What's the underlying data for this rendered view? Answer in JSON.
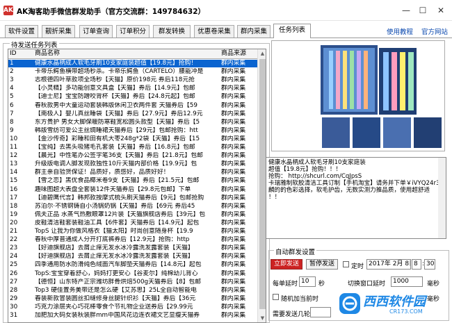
{
  "window": {
    "title": "AK淘客助手微信群发助手（官方交流群：149784632）",
    "app_icon": "AK",
    "min_glyph": "—",
    "max_glyph": "☐",
    "close_glyph": "✕"
  },
  "tabs": [
    {
      "label": "软件设置"
    },
    {
      "label": "靓折采集"
    },
    {
      "label": "订单查询"
    },
    {
      "label": "订单积分"
    },
    {
      "label": "群发转换"
    },
    {
      "label": "优惠卷采集"
    },
    {
      "label": "群内采集"
    },
    {
      "label": "任务列表"
    }
  ],
  "links": {
    "tutorial": "使用教程",
    "site": "官方网站"
  },
  "task_group": {
    "label": "待发送任务列表"
  },
  "list": {
    "headers": {
      "id": "ID",
      "name": "商品名称",
      "source": "商品来源"
    },
    "rows": [
      {
        "id": "1",
        "name": "健康水晶柄成人软毛牙刷10支家庭装超值【19.8元】抢购！",
        "source": "群内采集"
      },
      {
        "id": "2",
        "name": "卡帝乐鳄鱼横带超场秒杀。卡帝乐鳄鱼（CARTELO）腰能冲是",
        "source": "群内采集"
      },
      {
        "id": "3",
        "name": "志根德四叶草款项全场秒【天猫】原价198元 券后118元抢",
        "source": "群内采集"
      },
      {
        "id": "4",
        "name": "【小灵精】多功能创意文具盒【天猫】券后【14.9元】包邮",
        "source": "群内采集"
      },
      {
        "id": "5",
        "name": "【迪士尼】宝宝防蹭咬背杯【天猫】券后【24.8元起】包邮",
        "source": "群内采集"
      },
      {
        "id": "6",
        "name": "春秋款男中大童运动套装韩版休闲卫衣两件套 天猫券后【59",
        "source": "群内采集"
      },
      {
        "id": "7",
        "name": "【南极人】婴儿真丝睡袋【天猫】券后【27.9元】券后12.9元",
        "source": "群内采集"
      },
      {
        "id": "8",
        "name": "东方贵护 男女大脚保暖防寒鞋宽松圆头款型【天猫】券后【5",
        "source": "群内采集"
      },
      {
        "id": "9",
        "name": "韩版雪纺可爱公主丝绸睡裙天猫券后【29元】包邮抢购：htt",
        "source": "群内采集"
      },
      {
        "id": "10",
        "name": "【金沙传奇】彩睡和田有机大枣248g*2袋【天猫】券后【15",
        "source": "群内采集"
      },
      {
        "id": "11",
        "name": "【宝纯】去黑头吸猪毛孔套装【天猫】券后【16.8元】包邮",
        "source": "群内采集"
      },
      {
        "id": "12",
        "name": "【晨光】中性笔办公签字笔36支【天猫】券后【21.8元】包邮",
        "source": "群内采集"
      },
      {
        "id": "13",
        "name": "升级版电调人脚发现款独性10斤天猫内部价格【19.9元】包",
        "source": "群内采集"
      },
      {
        "id": "14",
        "name": "群主亲自验货保证！品质好，质感好，品质好好！",
        "source": "群内采集"
      },
      {
        "id": "15",
        "name": "【雪之恋】黑优食品椰米卷9支【天猫】券后【21.5元】包邮",
        "source": "群内采集"
      },
      {
        "id": "16",
        "name": "趣味图超大表盘全套装12件天猫券后【29.8元包邮】下单",
        "source": "群内采集"
      },
      {
        "id": "17",
        "name": "【迪碧鹰代言】韩邦款按摩式梳头刷天猫券后【9元】包邮抢购",
        "source": "群内采集"
      },
      {
        "id": "18",
        "name": "苏泊尔·不锈钢铸自小汤锅奶锅【天猫】券后【69元 券后45",
        "source": "群内采集"
      },
      {
        "id": "19",
        "name": "佩夫正品 水蒸气热敷眼罩12片装【天猫旗舰店券后【39元】包",
        "source": "群内采集"
      },
      {
        "id": "20",
        "name": "皮鞋清洁鞋套装鞋油工具【6件套】天猫券后【14.9元】起包",
        "source": "群内采集"
      },
      {
        "id": "21",
        "name": "TopS 让我为你做风格衣【猫太阳】时尚创意随身杯【19.9",
        "source": "群内采集"
      },
      {
        "id": "22",
        "name": "春秋中厚普通成人分开打底裤券后【12.9元】抢购：http",
        "source": "群内采集"
      },
      {
        "id": "23",
        "name": "【好迪旗舰店】去屑止痒无发水冰冷露洗发露套装【天猫】",
        "source": "群内采集"
      },
      {
        "id": "24",
        "name": "【好迪旗舰店】去屑止痒无发水冰冷露洗发露套装【天猫】",
        "source": "群内采集"
      },
      {
        "id": "25",
        "name": "四季通用防水防滑纯色绒面汽车脚垫天猫券后【14.8元】起包",
        "source": "群内采集"
      },
      {
        "id": "26",
        "name": "TopS:宝宝穿着舒心，妈妈打更安心【谷麦尔】纯棉幼儿背心",
        "source": "群内采集"
      },
      {
        "id": "27",
        "name": "【德恒】山东特产正宗潍坊胖骨烘焙500g天猫券后【8】包邮",
        "source": "群内采集"
      },
      {
        "id": "28",
        "name": "Top3 硬佳置务美带还是怎么硬【艾苏思】25L全自动智能电",
        "source": "群内采集"
      },
      {
        "id": "29",
        "name": "春装新款冒装圆丝扣缝修身丝腿针织衫【天猫】券后【36元",
        "source": "群内采集"
      },
      {
        "id": "30",
        "name": "巧克力涂层夹心巧花棒零食个节礼物企业送券后【29.99元",
        "source": "群内采集"
      },
      {
        "id": "31",
        "name": "加肥加大码女装秋装胖mm中国风花边连衣裙文艺显瘦天猫券",
        "source": "群内采集"
      }
    ]
  },
  "preview": {
    "lines": [
      "健康水晶柄成人软毛牙刷10支家庭装",
      "超值【19.8元】抢购！！！",
      "抢购： http://shcurl.com/CqJpsS",
      "卡瑞雅制软胶清洁工具订制【手机淘宝】请务并下单￥iVYQ24r3￥",
      "麟的的色彩选择，软毛护齿，无数实测力推品质，使用超舒适",
      "！！"
    ]
  },
  "auto_group": {
    "label": "自动群发设置",
    "start_btn": "立即发送",
    "pause_btn": "暂停发送",
    "timed_label": "定时",
    "date": "2017年 2月 8日",
    "hour": "8",
    "minute": "30",
    "delay_label": "每单延时",
    "delay_value": "10",
    "delay_unit": "秒",
    "switch_label": "切换窗口延时",
    "switch_value": "1000",
    "switch_unit": "毫秒",
    "rand_label": "随机加当前时",
    "rand_unit": "毫秒",
    "count_label": "需要发送几轮"
  },
  "watermark": {
    "text": "西西软件园",
    "sub": "CR173.COM"
  },
  "colors": {
    "selection": "#0a64d0",
    "primary_button": "#cc2222",
    "link": "#0645ad"
  }
}
